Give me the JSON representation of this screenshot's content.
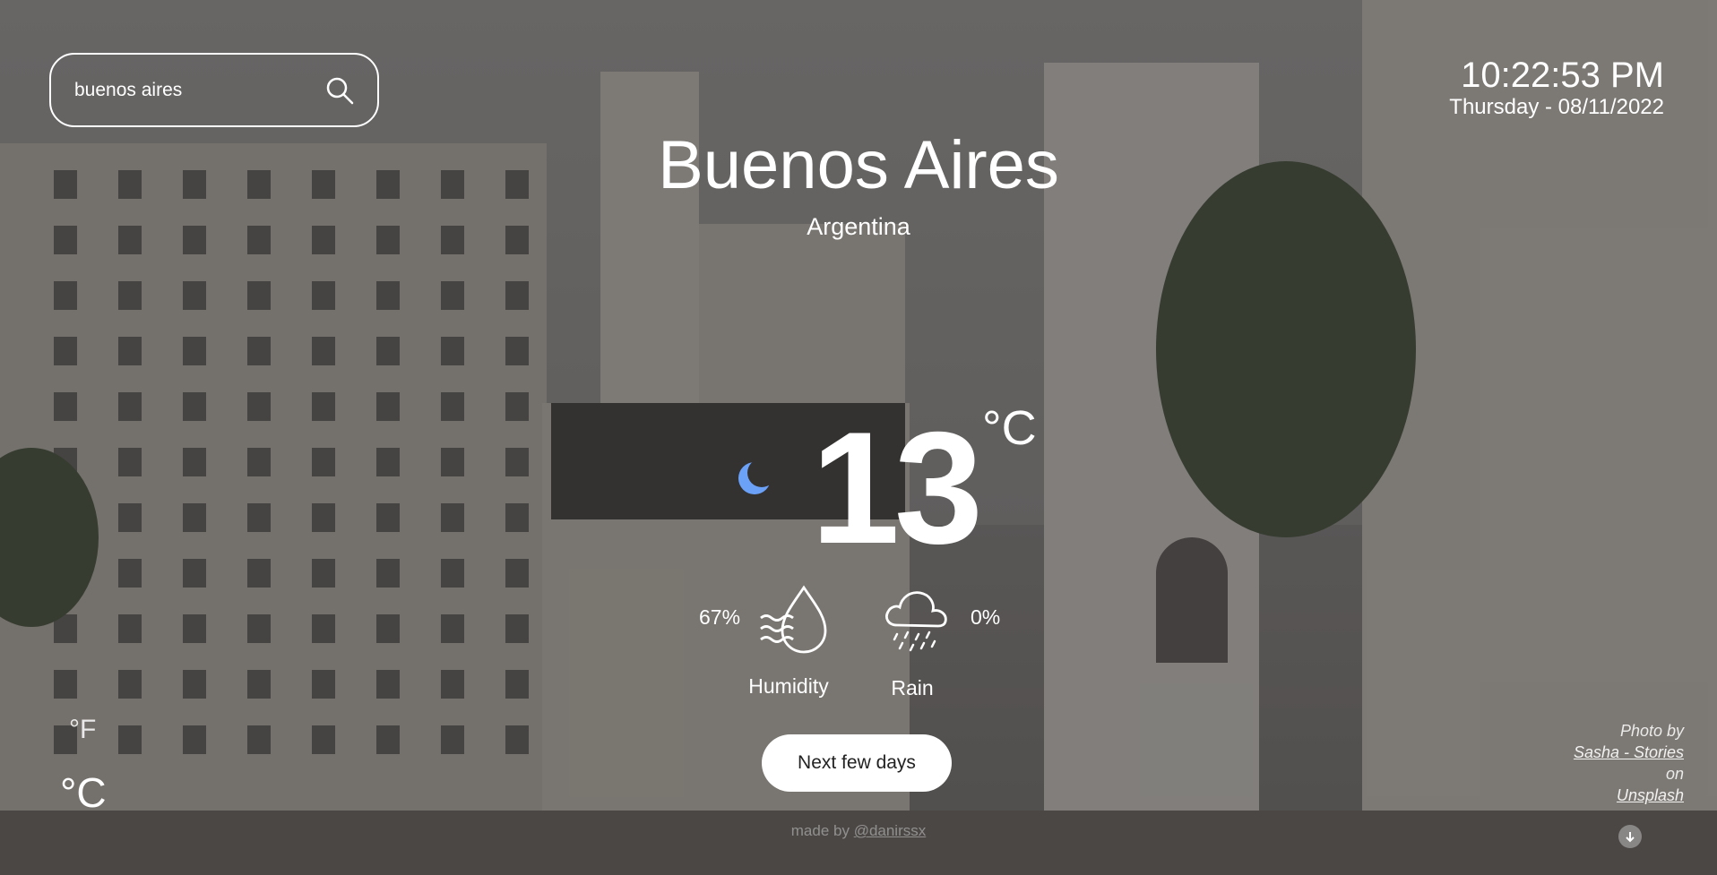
{
  "search": {
    "value": "buenos aires",
    "icon": "search-icon"
  },
  "clock": {
    "time": "10:22:53 PM",
    "date": "Thursday - 08/11/2022"
  },
  "location": {
    "city": "Buenos Aires",
    "country": "Argentina"
  },
  "current": {
    "temperature": "13",
    "unit": "°C",
    "condition_icon": "moon-icon",
    "humidity_value": "67%",
    "humidity_label": "Humidity",
    "rain_value": "0%",
    "rain_label": "Rain"
  },
  "actions": {
    "next_days": "Next few days"
  },
  "units": {
    "fahrenheit": "°F",
    "celsius": "°C"
  },
  "credits": {
    "made_by_prefix": "made by ",
    "made_by_author": "@danirssx",
    "photo_by": "Photo by",
    "photo_author": "Sasha - Stories",
    "photo_on": "on",
    "photo_site": "Unsplash"
  },
  "colors": {
    "text": "#ffffff",
    "button_bg": "#ffffff",
    "button_text": "#222222",
    "moon": "#3b82f6"
  }
}
